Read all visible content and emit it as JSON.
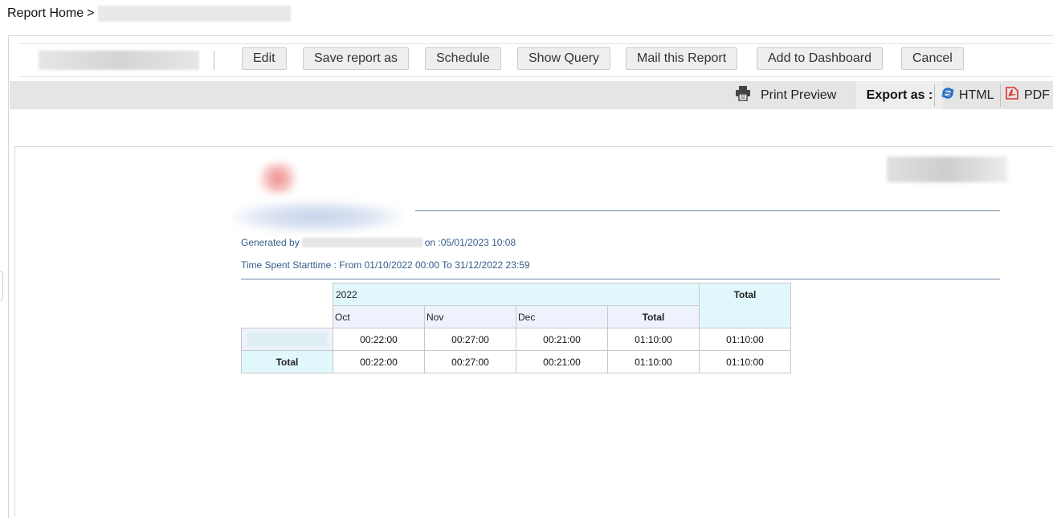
{
  "breadcrumb": {
    "home": "Report Home",
    "separator": ">"
  },
  "toolbar": {
    "buttons": [
      {
        "id": "edit",
        "label": "Edit"
      },
      {
        "id": "save_as",
        "label": "Save report as"
      },
      {
        "id": "schedule",
        "label": "Schedule"
      },
      {
        "id": "show_query",
        "label": "Show Query"
      },
      {
        "id": "mail",
        "label": "Mail this Report"
      },
      {
        "id": "add_dashboard",
        "label": "Add to Dashboard"
      },
      {
        "id": "cancel",
        "label": "Cancel"
      }
    ]
  },
  "exportbar": {
    "print_preview": "Print Preview",
    "export_label": "Export as :",
    "formats": [
      {
        "id": "html",
        "label": "HTML",
        "icon": "ie-icon"
      },
      {
        "id": "pdf",
        "label": "PDF",
        "icon": "pdf-icon"
      }
    ]
  },
  "report": {
    "generated_prefix": "Generated by",
    "generated_suffix": "on :05/01/2023 10:08",
    "time_filter": "Time Spent Starttime : From 01/10/2022 00:00 To 31/12/2022 23:59",
    "table": {
      "year": "2022",
      "grand_total_header": "Total",
      "months": [
        "Oct",
        "Nov",
        "Dec"
      ],
      "subtotal_header": "Total",
      "rows": [
        {
          "label": "",
          "values": [
            "00:22:00",
            "00:27:00",
            "00:21:00",
            "01:10:00",
            "01:10:00"
          ]
        },
        {
          "label": "Total",
          "values": [
            "00:22:00",
            "00:27:00",
            "00:21:00",
            "01:10:00",
            "01:10:00"
          ]
        }
      ]
    }
  },
  "colors": {
    "header_cyan": "#e0f8fc",
    "header_lavender": "#eef2fd",
    "meta_text": "#345d8a",
    "rule_line": "#6e8aa8",
    "pdf_red": "#d9302e",
    "ie_blue": "#1f6fc5"
  }
}
